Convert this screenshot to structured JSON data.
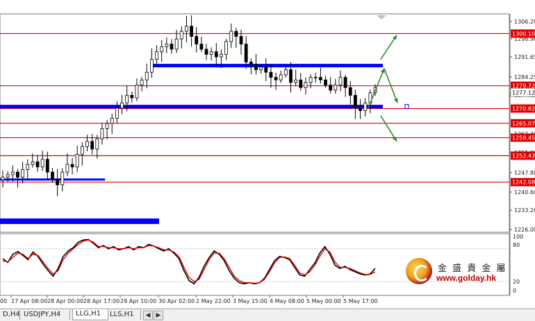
{
  "colors": {
    "grid": "#c8c8c8",
    "candle": "#000000",
    "hline": "#e00000",
    "zone": "#0000ff",
    "arrow": "#2e8b2e",
    "k": "#000000",
    "d": "#e00000",
    "price_bg": "#e00000"
  },
  "chart_data": [
    {
      "type": "candlestick",
      "symbol": "LLG",
      "timeframe": "H1",
      "x_tick_labels": [
        "27 Apr 08:00",
        "28 Apr 00:00",
        "28 Apr 17:00",
        "29 Apr 10:00",
        "30 Apr 02:00",
        "2 May 22:00",
        "3 May 15:00",
        "4 May 08:00",
        "5 May 00:00",
        "5 May 17:00"
      ],
      "x_tick_partial_left": "00",
      "y_range": [
        1222.5,
        1307.8
      ],
      "y_tick_labels": [
        "1306.20",
        "1298.90",
        "1291.65",
        "1284.25",
        "1277.12",
        "1262.40",
        "1255.25",
        "1247.80",
        "1240.60",
        "1233.20",
        "1226.00"
      ],
      "current_price": "1277.12",
      "close_path": [
        1244,
        1245,
        1246,
        1244,
        1247,
        1249,
        1250,
        1248,
        1251,
        1246,
        1243,
        1241,
        1246,
        1249,
        1248,
        1253,
        1256,
        1258,
        1255,
        1259,
        1263,
        1265,
        1267,
        1271,
        1273,
        1276,
        1275,
        1280,
        1282,
        1285,
        1290,
        1293,
        1295,
        1296,
        1294,
        1298,
        1301,
        1303,
        1299,
        1296,
        1294,
        1292,
        1293,
        1291,
        1292,
        1297,
        1301,
        1299,
        1296,
        1289,
        1288,
        1286,
        1287,
        1285,
        1283,
        1282,
        1284,
        1286,
        1281,
        1282,
        1279,
        1281,
        1283,
        1283,
        1282,
        1280,
        1278,
        1280,
        1283,
        1279,
        1276,
        1271,
        1270,
        1273,
        1277,
        1279
      ],
      "horizontal_lines": [
        {
          "label": "1300.10",
          "value": 1300.1
        },
        {
          "label": "1279.72",
          "value": 1279.72
        },
        {
          "label": "1270.82",
          "value": 1270.82
        },
        {
          "label": "1265.07",
          "value": 1265.07
        },
        {
          "label": "1259.45",
          "value": 1259.45
        },
        {
          "label": "1252.43",
          "value": 1252.43
        },
        {
          "label": "1242.08",
          "value": 1242.08
        }
      ],
      "blue_zones": [
        {
          "value": 1287.6,
          "x_from": "30 Apr 00:00",
          "x_to": "5 May 22:00"
        },
        {
          "value": 1271.6,
          "x_from": "left edge",
          "x_to": "5 May 22:00"
        },
        {
          "value": 1243.1,
          "x_from": "left edge",
          "x_to": "28 Apr 11:00"
        },
        {
          "value": 1226.8,
          "x_from": "left edge",
          "x_to": "29 Apr 22:00"
        }
      ],
      "arrows": [
        {
          "from": [
            1271.0,
            "5 May 20:00"
          ],
          "to": [
            1286.5,
            "6 May 02:00"
          ]
        },
        {
          "from": [
            1290.0,
            "6 May 01:00"
          ],
          "to": [
            1299.5,
            "6 May 07:00"
          ]
        },
        {
          "from": [
            1286.5,
            "6 May 02:00"
          ],
          "to": [
            1273.0,
            "6 May 08:00"
          ]
        },
        {
          "from": [
            1268.0,
            "6 May 01:00"
          ],
          "to": [
            1258.0,
            "6 May 07:00"
          ]
        }
      ]
    },
    {
      "type": "line",
      "indicator": "stochastic",
      "y_range": [
        0,
        100
      ],
      "y_tick_labels": [
        "100",
        "80",
        "20",
        "0"
      ],
      "series": [
        {
          "color": "#000000",
          "values": [
            62,
            55,
            70,
            75,
            68,
            60,
            74,
            66,
            52,
            40,
            30,
            44,
            66,
            76,
            82,
            92,
            96,
            97,
            90,
            82,
            86,
            80,
            84,
            78,
            80,
            84,
            78,
            84,
            82,
            88,
            85,
            80,
            76,
            80,
            72,
            62,
            40,
            22,
            16,
            28,
            48,
            64,
            76,
            70,
            58,
            40,
            26,
            18,
            16,
            18,
            16,
            18,
            26,
            42,
            58,
            66,
            64,
            60,
            46,
            32,
            30,
            42,
            54,
            72,
            84,
            70,
            50,
            44,
            48,
            42,
            38,
            34,
            32,
            34,
            44
          ]
        },
        {
          "color": "#e00000",
          "values": [
            58,
            56,
            64,
            72,
            70,
            62,
            70,
            68,
            56,
            44,
            34,
            40,
            60,
            72,
            80,
            88,
            94,
            96,
            92,
            84,
            84,
            82,
            82,
            80,
            80,
            82,
            80,
            82,
            82,
            86,
            85,
            82,
            78,
            78,
            74,
            66,
            46,
            28,
            20,
            24,
            42,
            60,
            72,
            72,
            62,
            46,
            30,
            22,
            18,
            18,
            17,
            18,
            24,
            38,
            54,
            64,
            65,
            62,
            50,
            36,
            32,
            38,
            50,
            66,
            80,
            74,
            56,
            46,
            46,
            44,
            40,
            36,
            33,
            33,
            38
          ]
        }
      ]
    }
  ],
  "tabs": [
    {
      "label": "D,H4",
      "active": false
    },
    {
      "label": "USDJPY,H4",
      "active": false
    },
    {
      "label": "LLG,H1",
      "active": true
    },
    {
      "label": "LLS,H1",
      "active": false
    }
  ],
  "tab_arrows": {
    "left": "◀",
    "right": "▶"
  },
  "logo": {
    "chinese": "金 盛 貴 金 屬",
    "url": "www.golday.hk"
  }
}
